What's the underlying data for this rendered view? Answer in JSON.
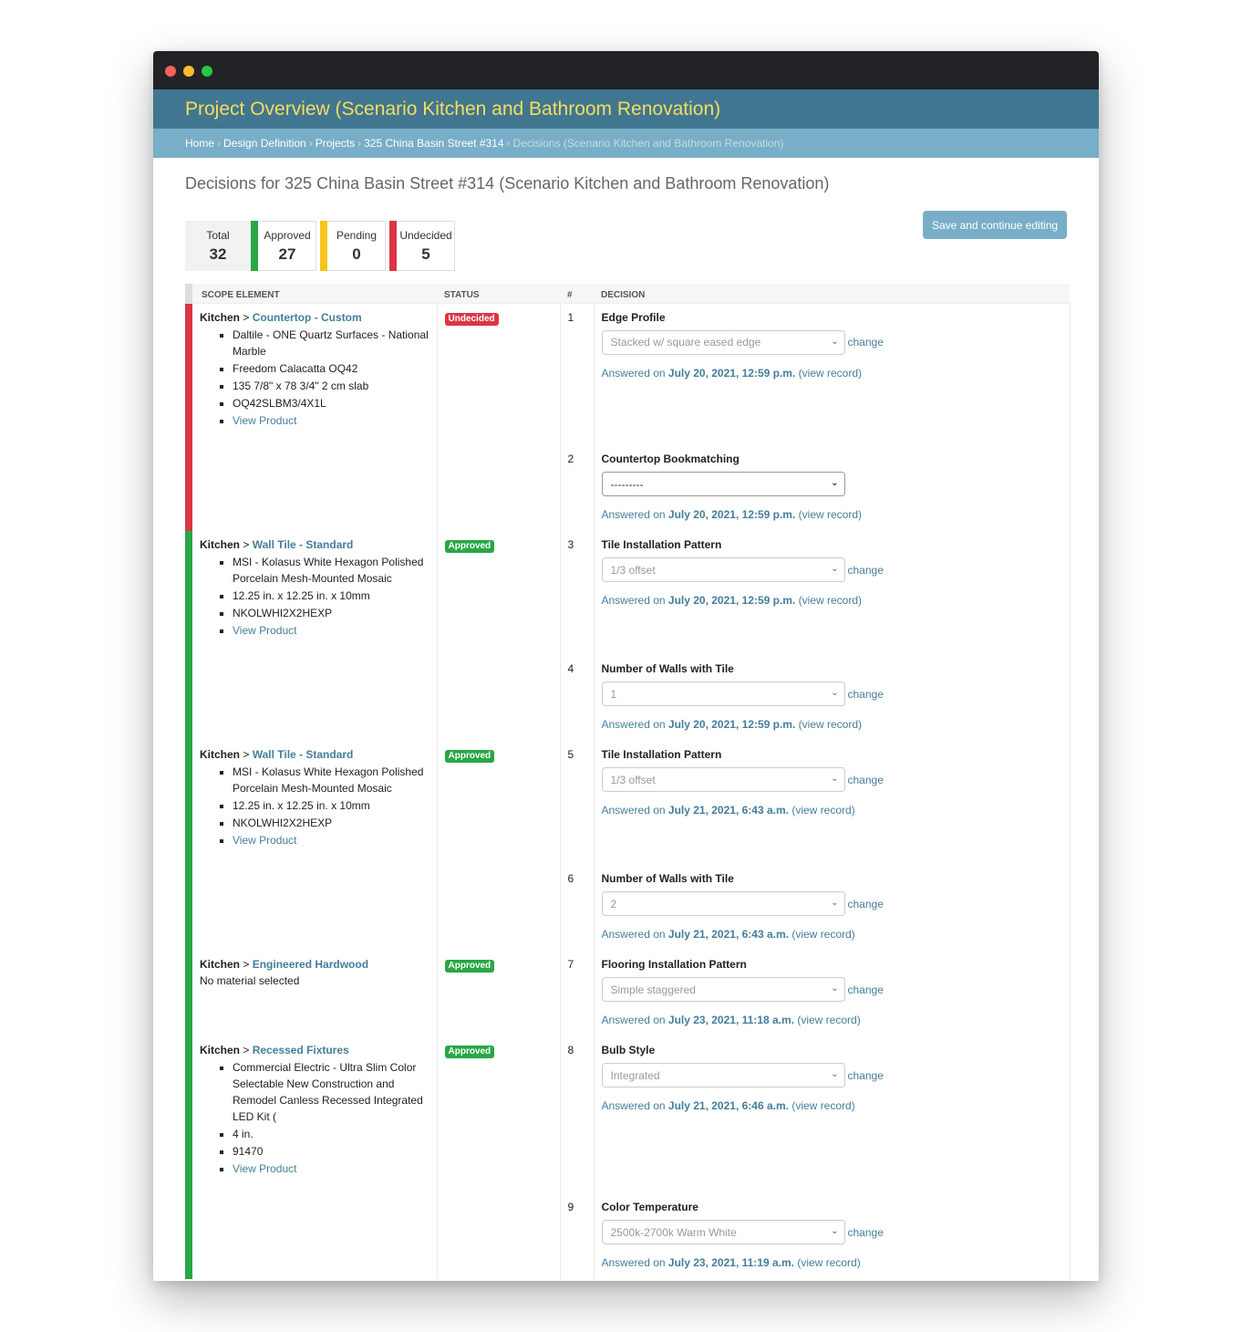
{
  "header": {
    "title": "Project Overview (Scenario Kitchen and Bathroom Renovation)"
  },
  "breadcrumbs": [
    "Home",
    "Design Definition",
    "Projects",
    "325 China Basin Street #314",
    "Decisions (Scenario Kitchen and Bathroom Renovation)"
  ],
  "page_title": "Decisions for 325 China Basin Street #314 (Scenario Kitchen and Bathroom Renovation)",
  "stats": {
    "total_label": "Total",
    "total": "32",
    "approved_label": "Approved",
    "approved": "27",
    "pending_label": "Pending",
    "pending": "0",
    "undecided_label": "Undecided",
    "undecided": "5"
  },
  "save_button": "Save and continue editing",
  "columns": {
    "scope": "Scope Element",
    "status": "Status",
    "num": "#",
    "decision": "Decision"
  },
  "colors": {
    "approved": "#28a745",
    "pending": "#f5c518",
    "undecided": "#dc3545",
    "header": "#417690",
    "breadcrumb": "#79aec8",
    "title": "#f5dd5d",
    "link": "#447e9b"
  },
  "rows": [
    {
      "room": "Kitchen",
      "category": "Countertop - Custom",
      "status": "Undecided",
      "items": [
        "Daltile - ONE Quartz Surfaces - National Marble",
        "Freedom Calacatta OQ42",
        "135 7/8\" x 78 3/4\" 2 cm slab",
        "OQ42SLBM3/4X1L",
        "View Product"
      ],
      "decisions": [
        {
          "num": "1",
          "title": "Edge Profile",
          "value": "Stacked w/ square eased edge",
          "change": "change",
          "answered_prefix": "Answered on",
          "date": "July 20, 2021, 12:59 p.m.",
          "record": "(view record)"
        },
        {
          "num": "2",
          "title": "Countertop Bookmatching",
          "value": "---------",
          "answered_prefix": "Answered on",
          "date": "July 20, 2021, 12:59 p.m.",
          "record": "(view record)"
        }
      ]
    },
    {
      "room": "Kitchen",
      "category": "Wall Tile - Standard",
      "status": "Approved",
      "items": [
        "MSI - Kolasus White Hexagon Polished Porcelain Mesh-Mounted Mosaic",
        "12.25 in. x 12.25 in. x 10mm",
        "NKOLWHI2X2HEXP",
        "View Product"
      ],
      "decisions": [
        {
          "num": "3",
          "title": "Tile Installation Pattern",
          "value": "1/3 offset",
          "change": "change",
          "answered_prefix": "Answered on",
          "date": "July 20, 2021, 12:59 p.m.",
          "record": "(view record)"
        },
        {
          "num": "4",
          "title": "Number of Walls with Tile",
          "value": "1",
          "change": "change",
          "answered_prefix": "Answered on",
          "date": "July 20, 2021, 12:59 p.m.",
          "record": "(view record)"
        }
      ]
    },
    {
      "room": "Kitchen",
      "category": "Wall Tile - Standard",
      "status": "Approved",
      "items": [
        "MSI - Kolasus White Hexagon Polished Porcelain Mesh-Mounted Mosaic",
        "12.25 in. x 12.25 in. x 10mm",
        "NKOLWHI2X2HEXP",
        "View Product"
      ],
      "decisions": [
        {
          "num": "5",
          "title": "Tile Installation Pattern",
          "value": "1/3 offset",
          "change": "change",
          "answered_prefix": "Answered on",
          "date": "July 21, 2021, 6:43 a.m.",
          "record": "(view record)"
        },
        {
          "num": "6",
          "title": "Number of Walls with Tile",
          "value": "2",
          "change": "change",
          "answered_prefix": "Answered on",
          "date": "July 21, 2021, 6:43 a.m.",
          "record": "(view record)"
        }
      ]
    },
    {
      "room": "Kitchen",
      "category": "Engineered Hardwood",
      "status": "Approved",
      "no_material": "No material selected",
      "decisions": [
        {
          "num": "7",
          "title": "Flooring Installation Pattern",
          "value": "Simple staggered",
          "change": "change",
          "answered_prefix": "Answered on",
          "date": "July 23, 2021, 11:18 a.m.",
          "record": "(view record)"
        }
      ]
    },
    {
      "room": "Kitchen",
      "category": "Recessed Fixtures",
      "status": "Approved",
      "items": [
        "Commercial Electric - Ultra Slim Color Selectable New Construction and Remodel Canless Recessed Integrated LED Kit (",
        "4 in.",
        "91470",
        "View Product"
      ],
      "decisions": [
        {
          "num": "8",
          "title": "Bulb Style",
          "value": "Integrated",
          "change": "change",
          "answered_prefix": "Answered on",
          "date": "July 21, 2021, 6:46 a.m.",
          "record": "(view record)"
        },
        {
          "num": "9",
          "title": "Color Temperature",
          "value": "2500k-2700k Warm White",
          "change": "change",
          "answered_prefix": "Answered on",
          "date": "July 23, 2021, 11:19 a.m.",
          "record": "(view record)"
        }
      ]
    }
  ]
}
